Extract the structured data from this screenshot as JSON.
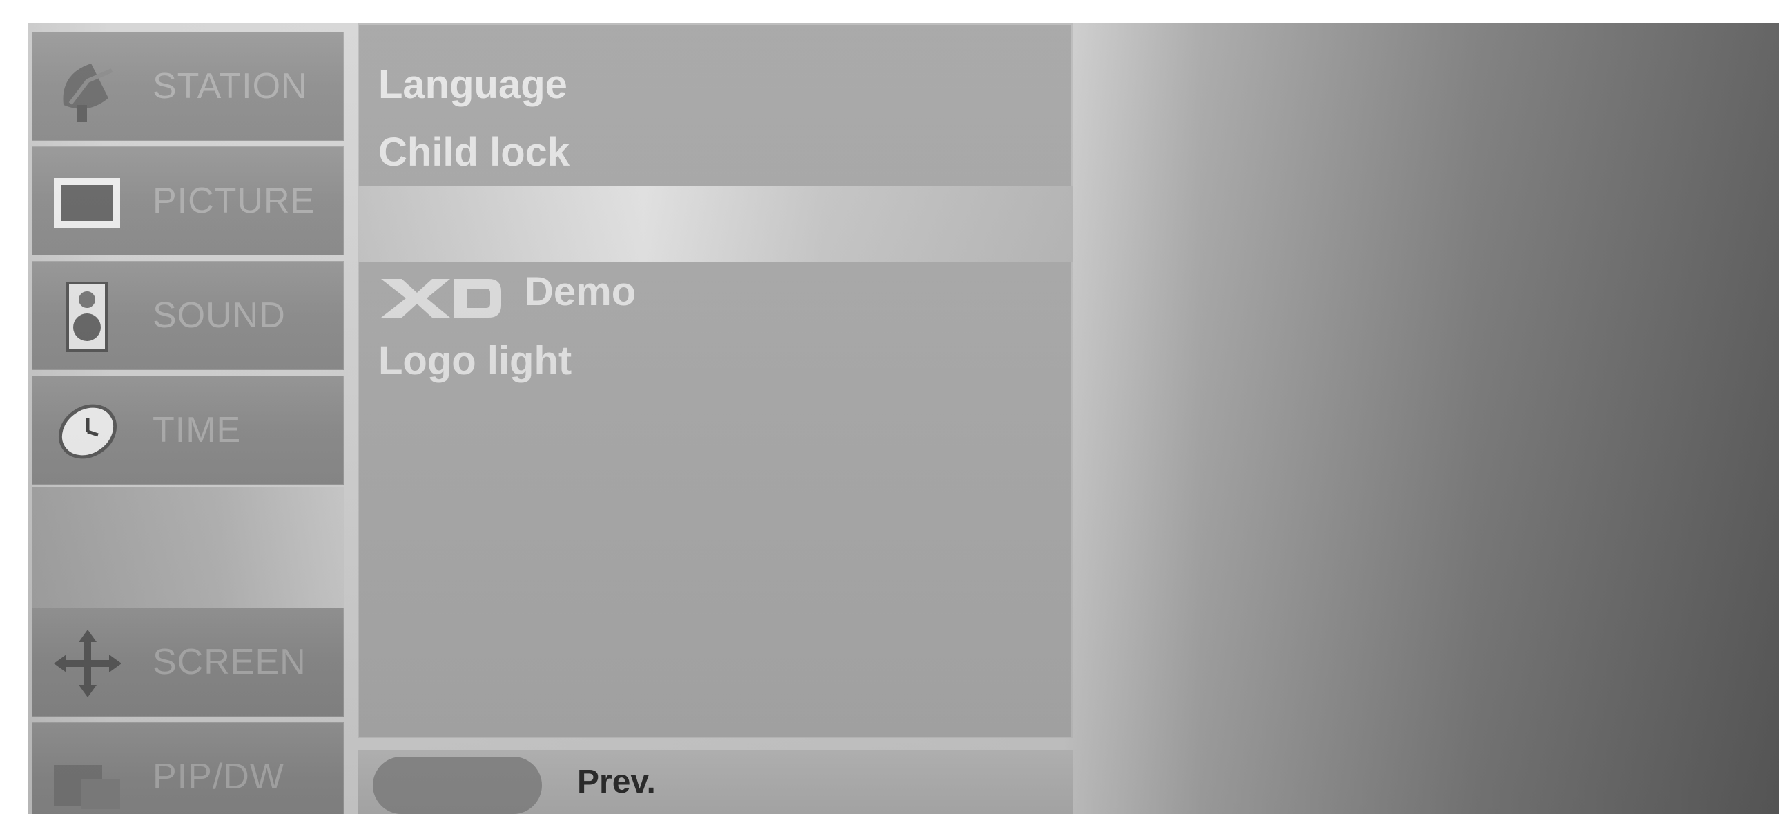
{
  "sidebar": {
    "items": [
      {
        "label": "STATION",
        "icon": "satellite-dish-icon"
      },
      {
        "label": "PICTURE",
        "icon": "tv-screen-icon"
      },
      {
        "label": "SOUND",
        "icon": "speaker-icon"
      },
      {
        "label": "TIME",
        "icon": "clock-icon"
      },
      {
        "label": "SCREEN",
        "icon": "move-arrows-icon"
      },
      {
        "label": "PIP/DW",
        "icon": "pip-icon"
      }
    ]
  },
  "menu": {
    "items": [
      {
        "label": "Language"
      },
      {
        "label": "Child lock"
      },
      {
        "label": ""
      },
      {
        "logo": "XD",
        "label": "Demo"
      },
      {
        "label": "Logo light"
      }
    ],
    "highlighted_index": 2
  },
  "footer": {
    "prev_label": "Prev."
  },
  "colors": {
    "panel": "#ababab",
    "highlight": "#dcdcdc",
    "sidebar_item": "#929292",
    "menu_text": "#e6e6e6"
  }
}
